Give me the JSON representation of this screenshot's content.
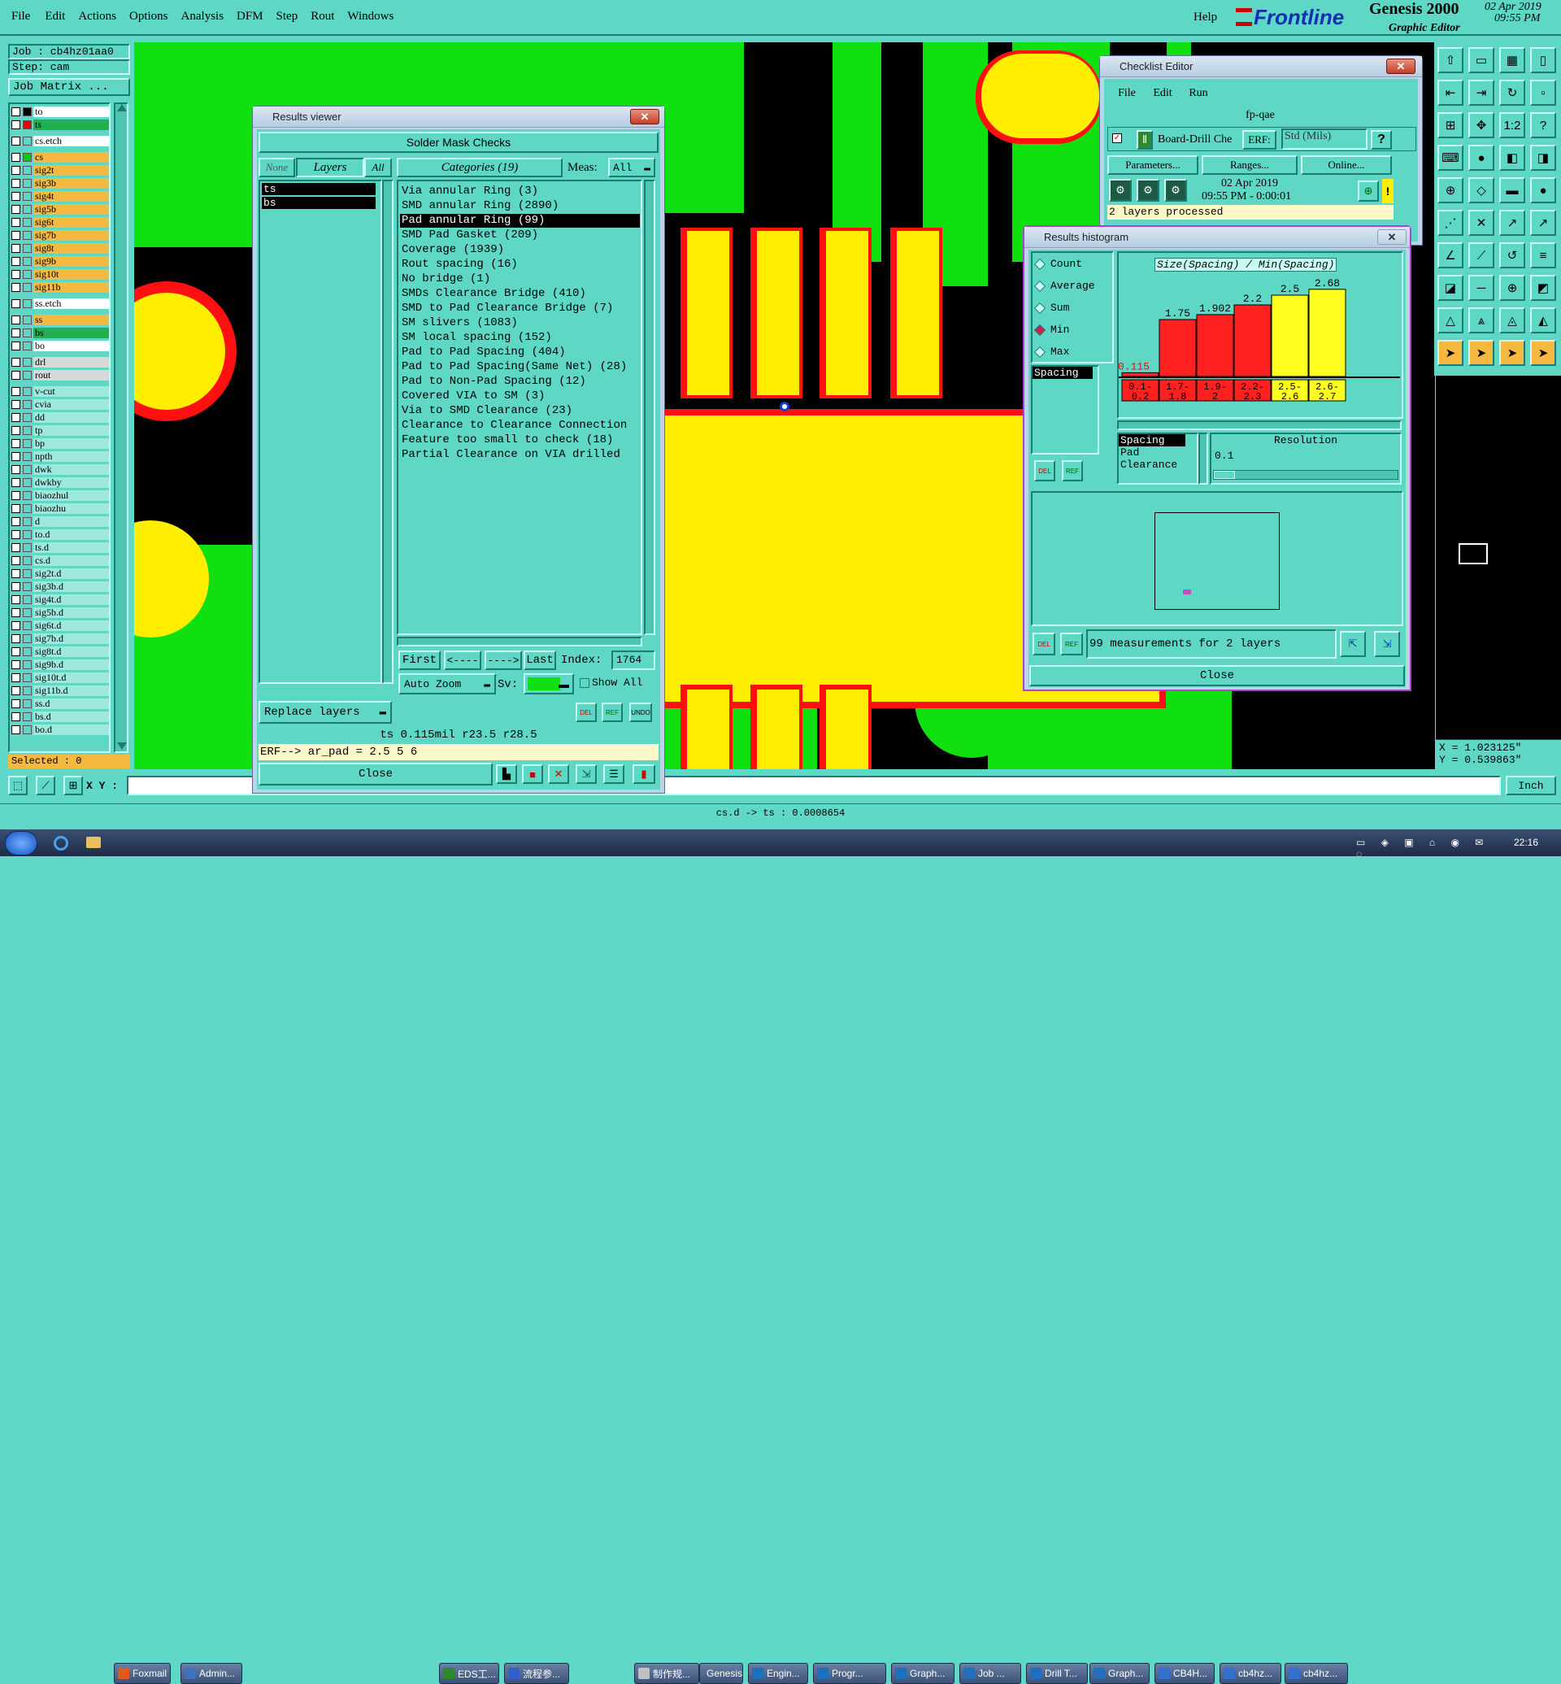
{
  "menu": [
    "File",
    "Edit",
    "Actions",
    "Options",
    "Analysis",
    "DFM",
    "Step",
    "Rout",
    "Windows"
  ],
  "help": "Help",
  "brand": {
    "logo": "Frontline",
    "product": "Genesis 2000",
    "subtitle": "Graphic Editor",
    "date": "02 Apr 2019",
    "time": "09:55 PM"
  },
  "job": {
    "job": "Job : cb4hz01aa0",
    "step": "Step: cam",
    "matrix": "Job Matrix ..."
  },
  "layers": [
    {
      "name": "to",
      "color": "#ffffff",
      "mark": "#000"
    },
    {
      "name": "ts",
      "color": "#20b050",
      "mark": "#e00"
    },
    {
      "name": "cs.etch",
      "color": "#ffffff",
      "mark": ""
    },
    {
      "name": "cs",
      "color": "#f5b840",
      "mark": "#0c0"
    },
    {
      "name": "sig2t",
      "color": "#f5b840",
      "mark": ""
    },
    {
      "name": "sig3b",
      "color": "#f5b840",
      "mark": ""
    },
    {
      "name": "sig4t",
      "color": "#f5b840",
      "mark": ""
    },
    {
      "name": "sig5b",
      "color": "#f5b840",
      "mark": ""
    },
    {
      "name": "sig6t",
      "color": "#f5b840",
      "mark": ""
    },
    {
      "name": "sig7b",
      "color": "#f5b840",
      "mark": ""
    },
    {
      "name": "sig8t",
      "color": "#f5b840",
      "mark": ""
    },
    {
      "name": "sig9b",
      "color": "#f5b840",
      "mark": ""
    },
    {
      "name": "sig10t",
      "color": "#f5b840",
      "mark": ""
    },
    {
      "name": "sig11b",
      "color": "#f5b840",
      "mark": ""
    },
    {
      "name": "ss.etch",
      "color": "#ffffff",
      "mark": ""
    },
    {
      "name": "ss",
      "color": "#f5b840",
      "mark": ""
    },
    {
      "name": "bs",
      "color": "#20b050",
      "mark": ""
    },
    {
      "name": "bo",
      "color": "#ffffff",
      "mark": ""
    },
    {
      "name": "drl",
      "color": "#d8d8d8",
      "mark": ""
    },
    {
      "name": "rout",
      "color": "#d8d8d8",
      "mark": ""
    },
    {
      "name": "v-cut",
      "color": "#9fe8dc",
      "mark": ""
    },
    {
      "name": "cvia",
      "color": "#9fe8dc",
      "mark": ""
    },
    {
      "name": "dd",
      "color": "#9fe8dc",
      "mark": ""
    },
    {
      "name": "tp",
      "color": "#9fe8dc",
      "mark": ""
    },
    {
      "name": "bp",
      "color": "#9fe8dc",
      "mark": ""
    },
    {
      "name": "npth",
      "color": "#9fe8dc",
      "mark": ""
    },
    {
      "name": "dwk",
      "color": "#9fe8dc",
      "mark": ""
    },
    {
      "name": "dwkby",
      "color": "#9fe8dc",
      "mark": ""
    },
    {
      "name": "biaozhul",
      "color": "#9fe8dc",
      "mark": ""
    },
    {
      "name": "biaozhu",
      "color": "#9fe8dc",
      "mark": ""
    },
    {
      "name": "d",
      "color": "#9fe8dc",
      "mark": ""
    },
    {
      "name": "to.d",
      "color": "#9fe8dc",
      "mark": ""
    },
    {
      "name": "ts.d",
      "color": "#9fe8dc",
      "mark": ""
    },
    {
      "name": "cs.d",
      "color": "#9fe8dc",
      "mark": ""
    },
    {
      "name": "sig2t.d",
      "color": "#9fe8dc",
      "mark": ""
    },
    {
      "name": "sig3b.d",
      "color": "#9fe8dc",
      "mark": ""
    },
    {
      "name": "sig4t.d",
      "color": "#9fe8dc",
      "mark": ""
    },
    {
      "name": "sig5b.d",
      "color": "#9fe8dc",
      "mark": ""
    },
    {
      "name": "sig6t.d",
      "color": "#9fe8dc",
      "mark": ""
    },
    {
      "name": "sig7b.d",
      "color": "#9fe8dc",
      "mark": ""
    },
    {
      "name": "sig8t.d",
      "color": "#9fe8dc",
      "mark": ""
    },
    {
      "name": "sig9b.d",
      "color": "#9fe8dc",
      "mark": ""
    },
    {
      "name": "sig10t.d",
      "color": "#9fe8dc",
      "mark": ""
    },
    {
      "name": "sig11b.d",
      "color": "#9fe8dc",
      "mark": ""
    },
    {
      "name": "ss.d",
      "color": "#9fe8dc",
      "mark": ""
    },
    {
      "name": "bs.d",
      "color": "#9fe8dc",
      "mark": ""
    },
    {
      "name": "bo.d",
      "color": "#9fe8dc",
      "mark": ""
    }
  ],
  "selected": "Selected : 0",
  "xy_label": "X Y :",
  "status_bar": "cs.d -> ts : 0.0008654",
  "units": "Inch",
  "coords": {
    "x": "X = 1.023125\"",
    "y": "Y = 0.539863\""
  },
  "results_viewer": {
    "title": "Results viewer",
    "header": "Solder Mask Checks",
    "none": "None",
    "layers_label": "Layers",
    "all": "All",
    "categories_label": "Categories (19)",
    "meas_label": "Meas:",
    "meas_value": "All",
    "layer_items": [
      "ts",
      "bs"
    ],
    "categories": [
      "Via annular Ring (3)",
      "SMD annular Ring (2890)",
      "Pad annular Ring (99)",
      "SMD Pad Gasket (209)",
      "Coverage (1939)",
      "Rout spacing (16)",
      "No bridge (1)",
      "SMDs Clearance Bridge (410)",
      "SMD to Pad Clearance Bridge (7)",
      "SM slivers (1083)",
      "SM local spacing (152)",
      "Pad to Pad Spacing (404)",
      "Pad to Pad Spacing(Same Net) (28)",
      "Pad to Non-Pad Spacing (12)",
      "Covered VIA to SM (3)",
      "Via to SMD Clearance (23)",
      "Clearance to Clearance Connection",
      "Feature too small to check (18)",
      "Partial Clearance on VIA drilled"
    ],
    "selected_index": 2,
    "first": "First",
    "prev": "<----",
    "next": "---->",
    "last": "Last",
    "index_label": "Index:",
    "index_value": "1764",
    "auto_zoom": "Auto Zoom",
    "sv": "Sv:",
    "show_all": "Show All",
    "replace_layers": "Replace layers",
    "info": "ts 0.115mil   r23.5   r28.5",
    "erf": "ERF--> ar_pad = 2.5 5 6",
    "close": "Close"
  },
  "checklist": {
    "title": "Checklist Editor",
    "menu": [
      "File",
      "Edit",
      "Run"
    ],
    "name": "fp-qae",
    "action": "Board-Drill Che",
    "erf": "ERF:",
    "erf_value": "Std (Mils)",
    "q": "?",
    "parameters": "Parameters...",
    "ranges": "Ranges...",
    "online": "Online...",
    "date": "02 Apr 2019",
    "time": "09:55 PM - 0:00:01",
    "processed": "2 layers processed"
  },
  "histogram": {
    "title": "Results histogram",
    "radio": [
      "Count",
      "Average",
      "Sum",
      "Min",
      "Max"
    ],
    "radio_selected": 3,
    "group": "Spacing",
    "chart_title": "Size(Spacing) / Min(Spacing)",
    "sort_items": [
      "Spacing",
      "Pad",
      "Clearance"
    ],
    "resolution_label": "Resolution",
    "resolution_value": "0.1",
    "measurements": "99 measurements for 2 layers",
    "close": "Close"
  },
  "chart_data": {
    "type": "bar",
    "title": "Size(Spacing) / Min(Spacing)",
    "categories": [
      "0.1-0.2",
      "1.7-1.8",
      "1.9-2",
      "2.2-2.3",
      "2.5-2.6",
      "2.6-2.7"
    ],
    "category_labels": [
      [
        "0.1-",
        "0.2"
      ],
      [
        "1.7-",
        "1.8"
      ],
      [
        "1.9-",
        "2"
      ],
      [
        "2.2-",
        "2.3"
      ],
      [
        "2.5-",
        "2.6"
      ],
      [
        "2.6-",
        "2.7"
      ]
    ],
    "values": [
      0.115,
      1.75,
      1.902,
      2.2,
      2.5,
      2.68
    ],
    "value_labels": [
      "0.115",
      "1.75",
      "1.902",
      "2.2",
      "2.5",
      "2.68"
    ],
    "colors": [
      "#ff2020",
      "#ff2020",
      "#ff2020",
      "#ff2020",
      "#ffff20",
      "#ffff20"
    ],
    "ylim": [
      0,
      2.9
    ]
  },
  "taskbar": {
    "items": [
      "Foxmail",
      "Admin...",
      "EDS工...",
      "流程参...",
      "制作规...",
      "Genesis",
      "Engin...",
      "Progr...",
      "Graph...",
      "Job ...",
      "Drill T...",
      "Graph...",
      "CB4H...",
      "cb4hz...",
      "cb4hz..."
    ],
    "clock": "22:16"
  },
  "colors": {
    "app_bg": "#5ed8c4",
    "board_green": "#10e010",
    "pad_yellow": "#ffee00",
    "clearance_red": "#ff1010"
  }
}
